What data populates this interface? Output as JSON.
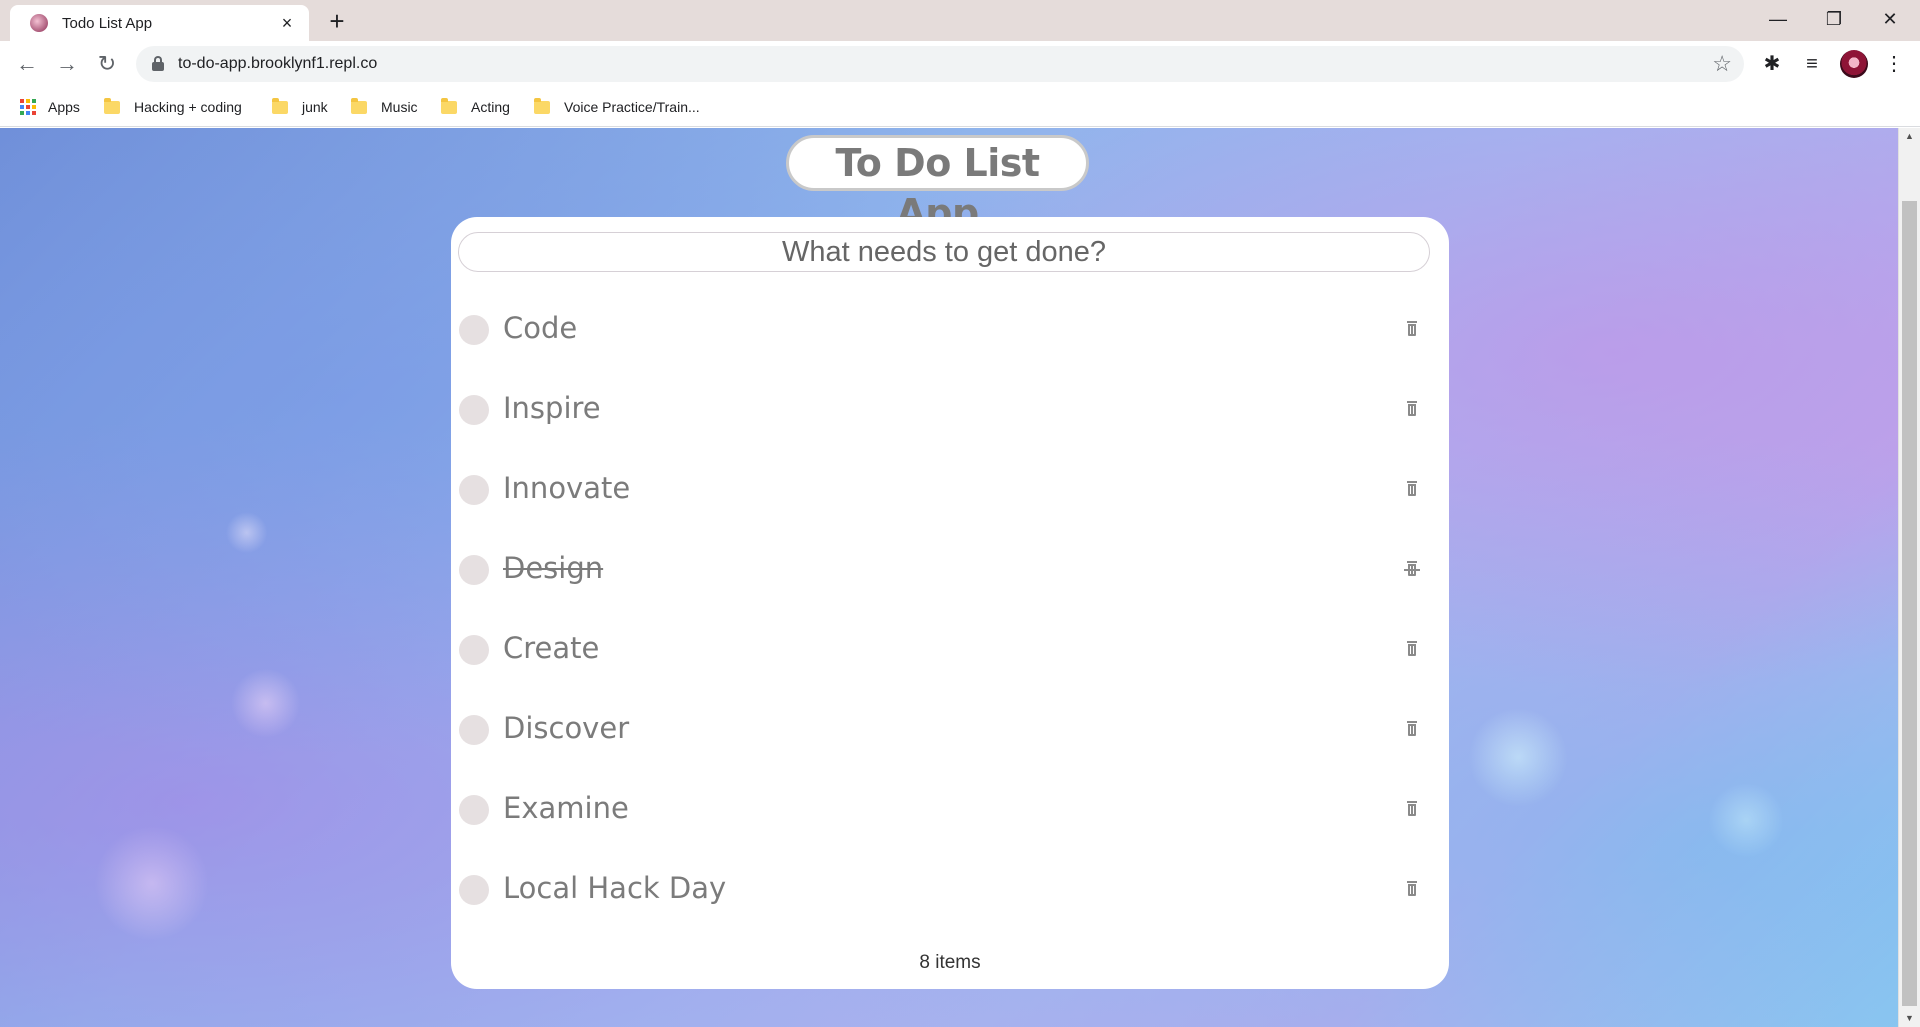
{
  "browser": {
    "tab_title": "Todo List App",
    "url": "to-do-app.brooklynf1.repl.co",
    "icons": {
      "tab_close": "×",
      "new_tab": "+",
      "back": "←",
      "forward": "→",
      "reload": "↻",
      "star": "☆",
      "minimize": "—",
      "restore": "❐",
      "close": "✕",
      "extensions": "✱",
      "media": "≡",
      "menu": "⋮"
    },
    "bookmarks": [
      {
        "label": "Apps",
        "type": "apps"
      },
      {
        "label": "Hacking + coding",
        "type": "folder"
      },
      {
        "label": "junk",
        "type": "folder"
      },
      {
        "label": "Music",
        "type": "folder"
      },
      {
        "label": "Acting",
        "type": "folder"
      },
      {
        "label": "Voice Practice/Train...",
        "type": "folder"
      }
    ],
    "colors": {
      "apps_dots": [
        "#ea4335",
        "#fbbc04",
        "#34a853",
        "#4285f4",
        "#ea4335",
        "#fbbc04",
        "#34a853",
        "#4285f4",
        "#ea4335"
      ]
    }
  },
  "app": {
    "title": "To Do List App",
    "input_placeholder": "What needs to get done?",
    "todos": [
      {
        "text": "Code",
        "done": false
      },
      {
        "text": "Inspire",
        "done": false
      },
      {
        "text": "Innovate",
        "done": false
      },
      {
        "text": "Design",
        "done": true
      },
      {
        "text": "Create",
        "done": false
      },
      {
        "text": "Discover",
        "done": false
      },
      {
        "text": "Examine",
        "done": false
      },
      {
        "text": "Local Hack Day",
        "done": false
      }
    ],
    "count_label": "8 items"
  },
  "scrollbar": {
    "up_arrow": "▲",
    "down_arrow": "▼"
  }
}
